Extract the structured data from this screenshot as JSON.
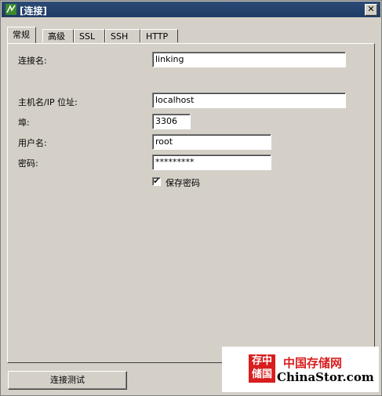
{
  "window": {
    "title": "[连接]",
    "close_glyph": "✕"
  },
  "tabs": [
    {
      "label": "常规",
      "active": true
    },
    {
      "label": "高级",
      "active": false
    },
    {
      "label": "SSL",
      "active": false
    },
    {
      "label": "SSH",
      "active": false
    },
    {
      "label": "HTTP",
      "active": false
    }
  ],
  "form": {
    "connection_name": {
      "label": "连接名:",
      "value": "linking"
    },
    "host": {
      "label": "主机名/IP 位址:",
      "value": "localhost"
    },
    "port": {
      "label": "埠:",
      "value": "3306"
    },
    "username": {
      "label": "用户名:",
      "value": "root"
    },
    "password": {
      "label": "密码:",
      "value": "*********"
    },
    "save_password": {
      "label": "保存密码",
      "checked": true,
      "glyph": "✔"
    }
  },
  "buttons": {
    "test_connection": "连接测试"
  },
  "watermark": {
    "logo_text": "存中储国",
    "cn_text": "中国存储网",
    "en_text": "ChinaStor.com"
  },
  "colors": {
    "titlebar": "#1e3b64",
    "window_bg": "#d4d0c8",
    "watermark_red": "#d81e1e"
  }
}
